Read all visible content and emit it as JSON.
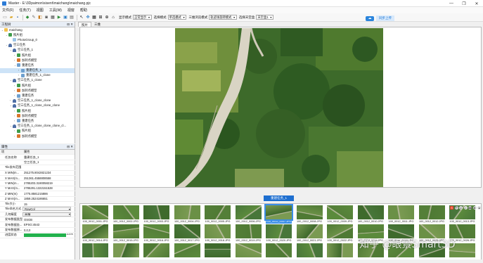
{
  "window": {
    "title": "Master - E:\\3Dpaimon\\sisent\\maichang\\maichang.pjc",
    "controls": [
      "—",
      "❐",
      "✕"
    ]
  },
  "menu": [
    "文件(F)",
    "任务(T)",
    "视图",
    "工具(W)",
    "视窗",
    "帮助"
  ],
  "toolbar": {
    "display_mode_label": "显示模式",
    "display_mode_value": "正常显示",
    "select_mode_label": "选择模式",
    "select_mode_value": "单选模式",
    "nav_mode_label": "三维浏览模式",
    "nav_mode_value": "轨迹球旋转模式",
    "axis_label": "选择天空盒",
    "axis_value": "天空盒1",
    "sync_label": "同步上传"
  },
  "project_panel": {
    "title": "工程树",
    "tree": [
      {
        "label": "maichang",
        "indent": 0,
        "icon": "folder",
        "exp": "⌄"
      },
      {
        "label": "照片组",
        "indent": 1,
        "icon": "img",
        "exp": "⌄"
      },
      {
        "label": "PhotoGroup_0",
        "indent": 2,
        "icon": "photo",
        "exp": ""
      },
      {
        "label": "空三任务",
        "indent": 1,
        "icon": "task",
        "exp": "⌄"
      },
      {
        "label": "空三任务_1",
        "indent": 2,
        "icon": "task",
        "exp": "⌄"
      },
      {
        "label": "照片组",
        "indent": 3,
        "icon": "img",
        "exp": "›"
      },
      {
        "label": "加刺点模型",
        "indent": 3,
        "icon": "tri",
        "exp": "›"
      },
      {
        "label": "重建任务",
        "indent": 3,
        "icon": "mesh",
        "exp": "⌄"
      },
      {
        "label": "重建任务_1",
        "indent": 4,
        "icon": "mesh",
        "exp": "›",
        "sel": true
      },
      {
        "label": "重建任务_1_clone",
        "indent": 4,
        "icon": "mesh",
        "exp": "›"
      },
      {
        "label": "空三任务_1_clone",
        "indent": 2,
        "icon": "task",
        "exp": "⌄"
      },
      {
        "label": "照片组",
        "indent": 3,
        "icon": "img",
        "exp": "›"
      },
      {
        "label": "加刺点模型",
        "indent": 3,
        "icon": "tri",
        "exp": "›"
      },
      {
        "label": "重建任务",
        "indent": 3,
        "icon": "mesh",
        "exp": "›"
      },
      {
        "label": "空三任务_1_clone_clone",
        "indent": 2,
        "icon": "task",
        "exp": "›"
      },
      {
        "label": "空三任务_1_clone_clone_clone",
        "indent": 2,
        "icon": "task",
        "exp": "⌄"
      },
      {
        "label": "照片组",
        "indent": 3,
        "icon": "img",
        "exp": "›"
      },
      {
        "label": "加刺点模型",
        "indent": 3,
        "icon": "tri",
        "exp": "›"
      },
      {
        "label": "重建任务",
        "indent": 3,
        "icon": "mesh",
        "exp": "›"
      },
      {
        "label": "空三任务_1_clone_clone_clone_cl...",
        "indent": 2,
        "icon": "task",
        "exp": "⌄"
      },
      {
        "label": "照片组",
        "indent": 3,
        "icon": "img",
        "exp": "›"
      },
      {
        "label": "加刺点模型",
        "indent": 3,
        "icon": "tri",
        "exp": "›"
      }
    ]
  },
  "prop_panel": {
    "title": "属性",
    "header_k": "项",
    "header_v": "属性",
    "rows": [
      {
        "k": "任务名称",
        "v": "重建任务_1"
      },
      {
        "k": "",
        "v": "空三任务_1"
      },
      {
        "k": "Tile发布范围",
        "v": ""
      },
      {
        "k": "X MIN(m...",
        "v": "251275.8042821234"
      },
      {
        "k": "X MAX(m...",
        "v": "251361.4558808558"
      },
      {
        "k": "Y MIN(m...",
        "v": "2785203.3190058219"
      },
      {
        "k": "Y MAX(m...",
        "v": "2785291.1322151528"
      },
      {
        "k": "Z MIN(m)",
        "v": "1775.8581215886"
      },
      {
        "k": "Z MAX(m...",
        "v": "1859.2524186651"
      },
      {
        "k": "Tile大小",
        "v": "15"
      },
      {
        "k": "Tile命名方式",
        "v": "RowCol",
        "box": true
      },
      {
        "k": "几何精度",
        "v": "高精",
        "box": true
      },
      {
        "k": "发布数据类型",
        "v": "OSGB"
      },
      {
        "k": "发布数据坐...",
        "v": "EPSG:4543"
      },
      {
        "k": "发布数据原...",
        "v": "0,0,0"
      },
      {
        "k": "进度状态",
        "v": "",
        "progress": 100,
        "pct": "100%"
      }
    ]
  },
  "view": {
    "tabs": [
      "照片",
      "三维"
    ]
  },
  "strip": {
    "label": "重建任务_1",
    "rows": [
      [
        "100_0012_0001.JPG",
        "100_0012_0002.JPG",
        "100_0012_0003.JPG",
        "100_0012_0004.JPG",
        "100_0012_0005.JPG",
        "100_0012_0006.JPG",
        "100_0012_0007.JPG",
        "100_0012_0008.JPG",
        "100_0012_0009.JPG",
        "100_0012_0010.JPG",
        "100_0012_0011.JPG",
        "100_0012_0012.JPG",
        "100_0012_0013.JPG"
      ],
      [
        "100_0012_0014.JPG",
        "100_0012_0015.JPG",
        "100_0012_0016.JPG",
        "100_0012_0017.JPG",
        "100_0012_0018.JPG",
        "100_0012_0019.JPG",
        "100_0012_0020.JPG",
        "100_0012_0021.JPG",
        "100_0012_0022.JPG",
        "100_0012_0023.JPG",
        "100_0012_0024.JPG",
        "100_0012_0025.JPG",
        "100_0012_0026.JPG"
      ],
      [
        "",
        "",
        "",
        "",
        "",
        "",
        "",
        "",
        "",
        "",
        "",
        "",
        ""
      ]
    ],
    "selected_index": 6
  },
  "watermark": "知乎 @眼景Smart3D"
}
